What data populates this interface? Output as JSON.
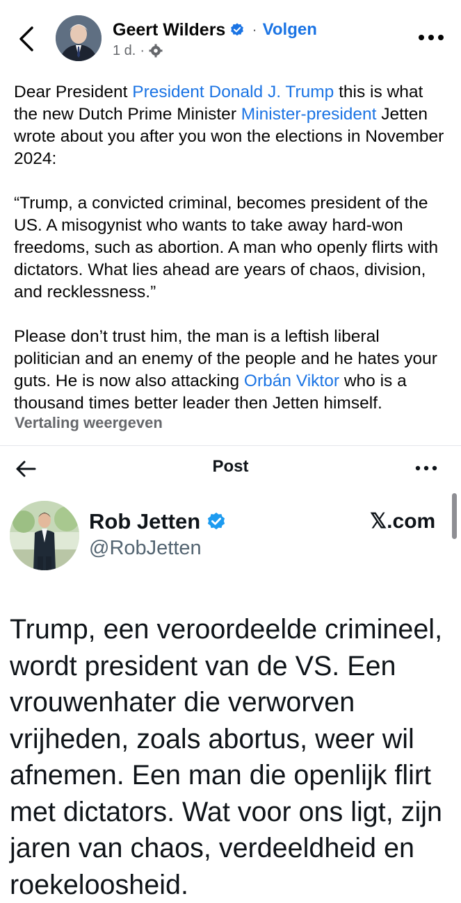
{
  "facebook": {
    "author": "Geert Wilders",
    "follow_label": "Volgen",
    "time": "1 d.",
    "paragraphs": [
      [
        {
          "t": "Dear President "
        },
        {
          "t": "President Donald J. Trump",
          "link": true
        },
        {
          "t": " this is what the new Dutch Prime Minister "
        },
        {
          "t": "Minister-president",
          "link": true
        },
        {
          "t": " Jetten wrote about you after you won the elections in November 2024:"
        }
      ],
      [
        {
          "t": "“Trump, a convicted criminal, becomes president of the US. A misogynist who wants to take away hard-won freedoms, such as abortion. A man who openly flirts with dictators. What lies ahead are years of chaos, division, and recklessness.”"
        }
      ],
      [
        {
          "t": "Please don’t trust him, the man is a leftish liberal politician and an enemy of the people and he hates your guts. He is now also attacking "
        },
        {
          "t": "Orbán Viktor",
          "link": true
        },
        {
          "t": " who is a thousand times better leader then Jetten himself."
        }
      ]
    ],
    "translate_label": "Vertaling weergeven"
  },
  "x_post": {
    "header_title": "Post",
    "name": "Rob Jetten",
    "handle": "@RobJetten",
    "site": "𝕏.com",
    "text": "Trump, een veroordeelde crimineel, wordt president van de VS. Een vrouwenhater die verworven vrijheden, zoals abortus, weer wil afnemen. Een man die openlijk flirt met dictators. Wat voor ons ligt, zijn jaren van chaos, verdeeldheid en roekeloosheid."
  },
  "colors": {
    "link": "#1b74e4",
    "verified": "#1d9bf0",
    "muted": "#65676b"
  }
}
